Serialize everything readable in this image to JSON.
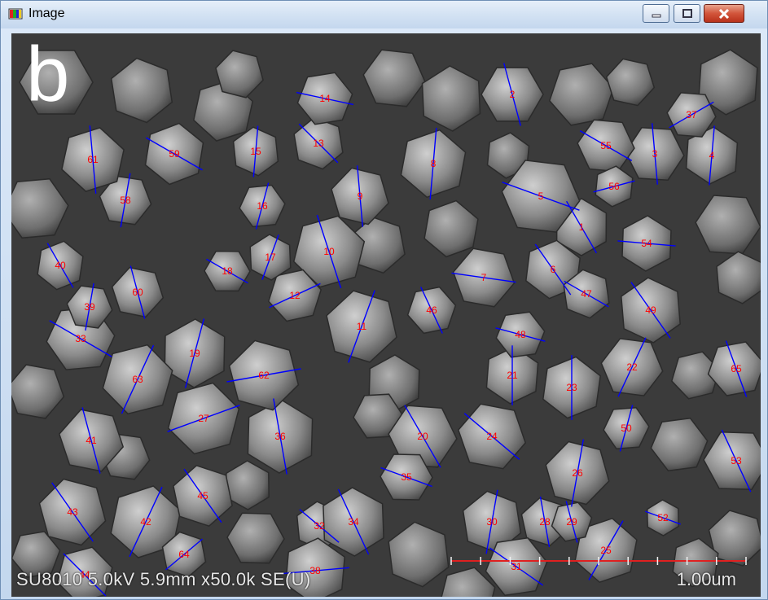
{
  "window": {
    "title": "Image",
    "icons": {
      "app": "image-app-icon",
      "minimize": "minimize-icon",
      "maximize": "maximize-icon",
      "close": "close-icon"
    }
  },
  "micrograph": {
    "panel_label": "b",
    "caption": "SU8010 5.0kV 5.9mm x50.0k SE(U)",
    "scale_bar_label": "1.00um",
    "annotation_color": "#0000ff",
    "label_color": "#ff0000",
    "labels": [
      "1",
      "2",
      "3",
      "4",
      "5",
      "6",
      "7",
      "8",
      "9",
      "10",
      "11",
      "12",
      "13",
      "14",
      "15",
      "16",
      "17",
      "18",
      "19",
      "20",
      "21",
      "22",
      "23",
      "24",
      "25",
      "26",
      "27",
      "28",
      "29",
      "30",
      "31",
      "32",
      "33",
      "34",
      "35",
      "36",
      "37",
      "38",
      "39",
      "40",
      "41",
      "42",
      "43",
      "44",
      "45",
      "46",
      "47",
      "48",
      "49",
      "50",
      "52",
      "53",
      "54",
      "55",
      "56",
      "58",
      "59",
      "60",
      "61",
      "62",
      "63",
      "64",
      "65"
    ]
  }
}
